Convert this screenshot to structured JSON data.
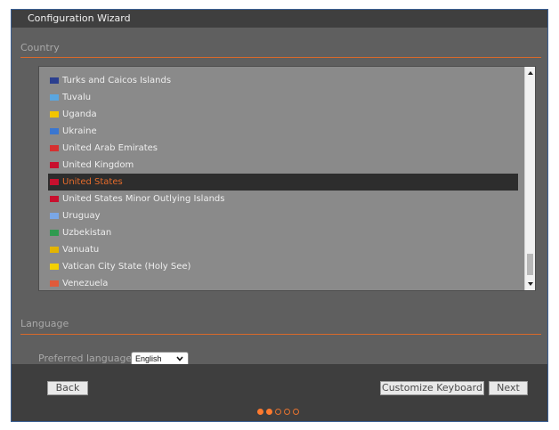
{
  "window": {
    "title": "Configuration Wizard"
  },
  "country": {
    "section_label": "Country",
    "items": [
      {
        "label": "Turks and Caicos Islands",
        "flag_color": "#2b3f8f",
        "selected": false
      },
      {
        "label": "Tuvalu",
        "flag_color": "#5aa6e0",
        "selected": false
      },
      {
        "label": "Uganda",
        "flag_color": "#f2c500",
        "selected": false
      },
      {
        "label": "Ukraine",
        "flag_color": "#3a76d0",
        "selected": false
      },
      {
        "label": "United Arab Emirates",
        "flag_color": "#d63030",
        "selected": false
      },
      {
        "label": "United Kingdom",
        "flag_color": "#c8102e",
        "selected": false
      },
      {
        "label": "United States",
        "flag_color": "#c8102e",
        "selected": true
      },
      {
        "label": "United States Minor Outlying Islands",
        "flag_color": "#c8102e",
        "selected": false
      },
      {
        "label": "Uruguay",
        "flag_color": "#7aa7e6",
        "selected": false
      },
      {
        "label": "Uzbekistan",
        "flag_color": "#2f9a4f",
        "selected": false
      },
      {
        "label": "Vanuatu",
        "flag_color": "#e3b400",
        "selected": false
      },
      {
        "label": "Vatican City State (Holy See)",
        "flag_color": "#f3d000",
        "selected": false
      },
      {
        "label": "Venezuela",
        "flag_color": "#e05a3a",
        "selected": false
      }
    ],
    "selected_color": "#e56b2b"
  },
  "language": {
    "section_label": "Language",
    "preferred_label": "Preferred language:",
    "selected": "English"
  },
  "footer": {
    "back_label": "Back",
    "customize_label": "Customize Keyboard",
    "next_label": "Next",
    "steps_total": 5,
    "steps_done": 2
  },
  "colors": {
    "accent": "#e56b2b",
    "panel": "#5f5f5f",
    "footer": "#3e3e3e"
  }
}
